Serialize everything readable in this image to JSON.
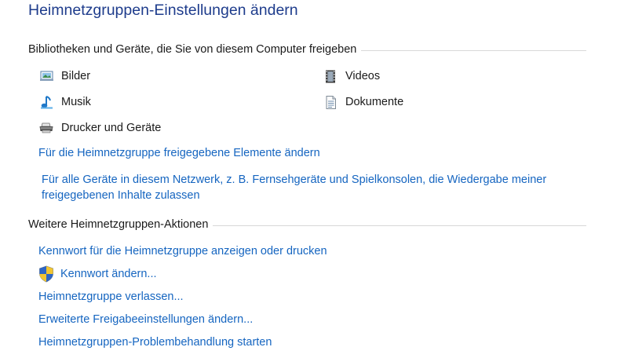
{
  "title": "Heimnetzgruppen-Einstellungen ändern",
  "libraries": {
    "heading": "Bibliotheken und Geräte, die Sie von diesem Computer freigeben",
    "items": [
      {
        "label": "Bilder",
        "icon": "pictures-icon"
      },
      {
        "label": "Videos",
        "icon": "videos-icon"
      },
      {
        "label": "Musik",
        "icon": "music-icon"
      },
      {
        "label": "Dokumente",
        "icon": "documents-icon"
      },
      {
        "label": "Drucker und Geräte",
        "icon": "printer-icon"
      }
    ],
    "change_shared_link": "Für die Heimnetzgruppe freigegebene Elemente ändern",
    "stream_link": "Für alle Geräte in diesem Netzwerk, z. B. Fernsehgeräte und Spielkonsolen, die Wiedergabe meiner freigegebenen Inhalte zulassen"
  },
  "actions": {
    "heading": "Weitere Heimnetzgruppen-Aktionen",
    "view_password": "Kennwort für die Heimnetzgruppe anzeigen oder drucken",
    "change_password": "Kennwort ändern...",
    "leave": "Heimnetzgruppe verlassen...",
    "advanced_sharing": "Erweiterte Freigabeeinstellungen ändern...",
    "troubleshoot": "Heimnetzgruppen-Problembehandlung starten"
  },
  "colors": {
    "title": "#1e3c8c",
    "link": "#1565c0"
  }
}
